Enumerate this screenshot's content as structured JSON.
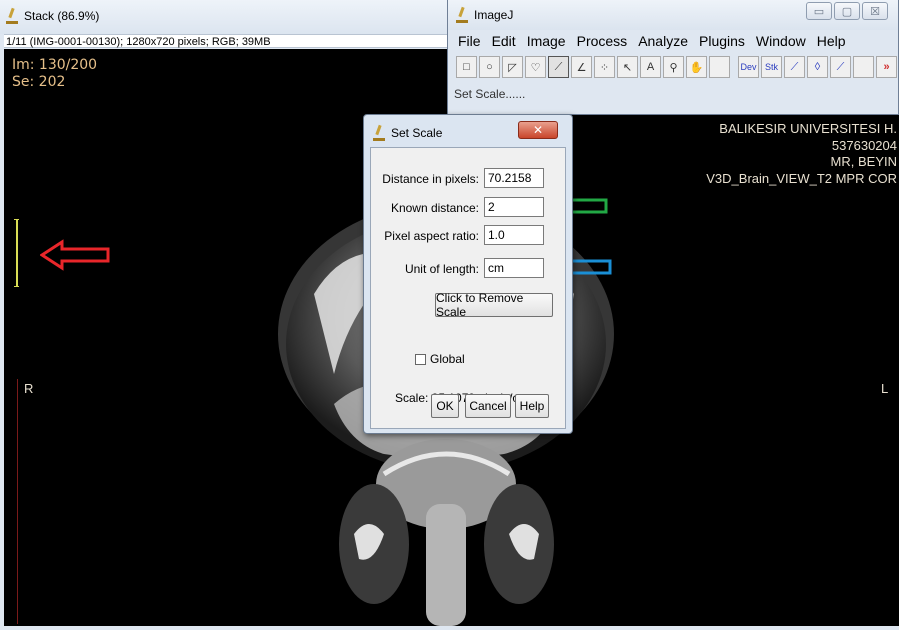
{
  "stack_window": {
    "title": "Stack (86.9%)",
    "info": "1/11 (IMG-0001-00130); 1280x720 pixels; RGB; 39MB",
    "overlay_top_left": [
      "Im: 130/200",
      "Se: 202"
    ],
    "overlay_top_right": [
      "BALIKESIR UNIVERSITESI H.",
      "537630204",
      "MR, BEYIN",
      "V3D_Brain_VIEW_T2 MPR COR"
    ],
    "left_marker": "R",
    "right_marker": "L"
  },
  "imagej_window": {
    "title": "ImageJ",
    "menu": [
      "File",
      "Edit",
      "Image",
      "Process",
      "Analyze",
      "Plugins",
      "Window",
      "Help"
    ],
    "tools": [
      {
        "name": "rectangle-tool",
        "glyph": "□"
      },
      {
        "name": "oval-tool",
        "glyph": "○"
      },
      {
        "name": "polygon-tool",
        "glyph": "◸"
      },
      {
        "name": "freehand-tool",
        "glyph": "♡"
      },
      {
        "name": "line-tool",
        "glyph": "⟋"
      },
      {
        "name": "angle-tool",
        "glyph": "∠"
      },
      {
        "name": "point-tool",
        "glyph": "⁘"
      },
      {
        "name": "wand-tool",
        "glyph": "↖"
      },
      {
        "name": "text-tool",
        "glyph": "A"
      },
      {
        "name": "magnifier-tool",
        "glyph": "⚲"
      },
      {
        "name": "hand-tool",
        "glyph": "✋"
      },
      {
        "name": "color-picker-tool",
        "glyph": ""
      },
      {
        "name": "dev-tool",
        "glyph": "Dev"
      },
      {
        "name": "stk-tool",
        "glyph": "Stk"
      },
      {
        "name": "brush-tool",
        "glyph": "⟋"
      },
      {
        "name": "flood-fill-tool",
        "glyph": "◊"
      },
      {
        "name": "arrow-tool",
        "glyph": "⟋"
      },
      {
        "name": "blank-tool",
        "glyph": ""
      },
      {
        "name": "more-tools",
        "glyph": "»"
      }
    ],
    "status": "Set Scale......",
    "controls": {
      "minimize": "▭",
      "maximize": "▢",
      "close": "☒"
    }
  },
  "set_scale_dialog": {
    "title": "Set Scale",
    "close_glyph": "✕",
    "fields": {
      "distance_label": "Distance in pixels:",
      "distance_value": "70.2158",
      "known_label": "Known distance:",
      "known_value": "2",
      "aspect_label": "Pixel aspect ratio:",
      "aspect_value": "1.0",
      "unit_label": "Unit of length:",
      "unit_value": "cm"
    },
    "remove_scale_button": "Click to Remove Scale",
    "global_label": "Global",
    "scale_text": "Scale: 35.1079 pixels/cm",
    "buttons": {
      "ok": "OK",
      "cancel": "Cancel",
      "help": "Help"
    }
  },
  "colors": {
    "arrow_red": "#e8262a",
    "arrow_green": "#22a845",
    "arrow_blue": "#1a8fd6",
    "scale_bar": "#d9dd55"
  }
}
